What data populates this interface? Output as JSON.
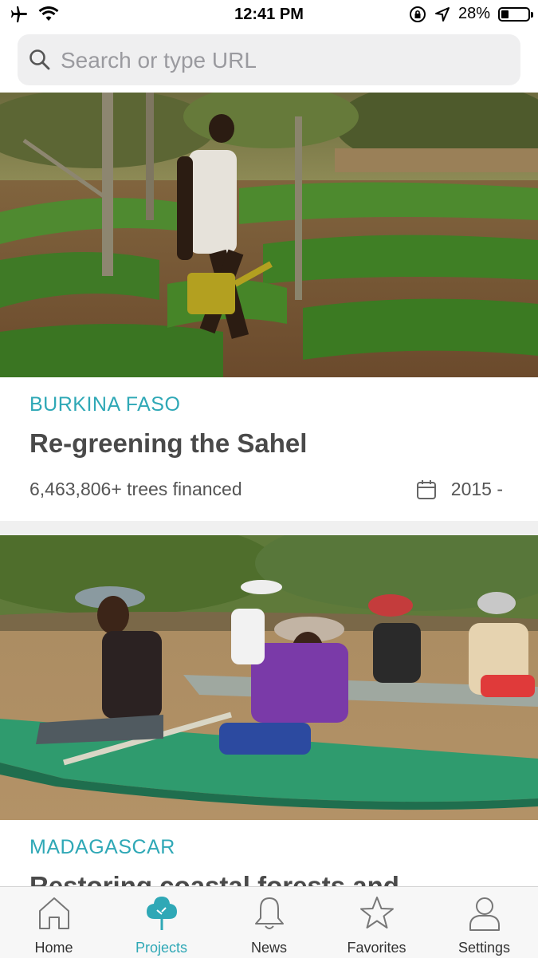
{
  "status_bar": {
    "time": "12:41 PM",
    "battery": "28%",
    "battery_level": 0.28
  },
  "search": {
    "placeholder": "Search or type URL"
  },
  "projects": [
    {
      "country": "BURKINA FASO",
      "title": "Re-greening the Sahel",
      "trees_financed": "6,463,806+ trees financed",
      "start": "2015 -"
    },
    {
      "country": "MADAGASCAR",
      "title": "Restoring coastal forests and"
    }
  ],
  "tabs": [
    {
      "label": "Home",
      "icon": "home-icon"
    },
    {
      "label": "Projects",
      "icon": "tree-icon"
    },
    {
      "label": "News",
      "icon": "bell-icon"
    },
    {
      "label": "Favorites",
      "icon": "star-icon"
    },
    {
      "label": "Settings",
      "icon": "person-icon"
    }
  ],
  "colors": {
    "accent": "#2fa8b6",
    "title": "#4a4a4a"
  }
}
